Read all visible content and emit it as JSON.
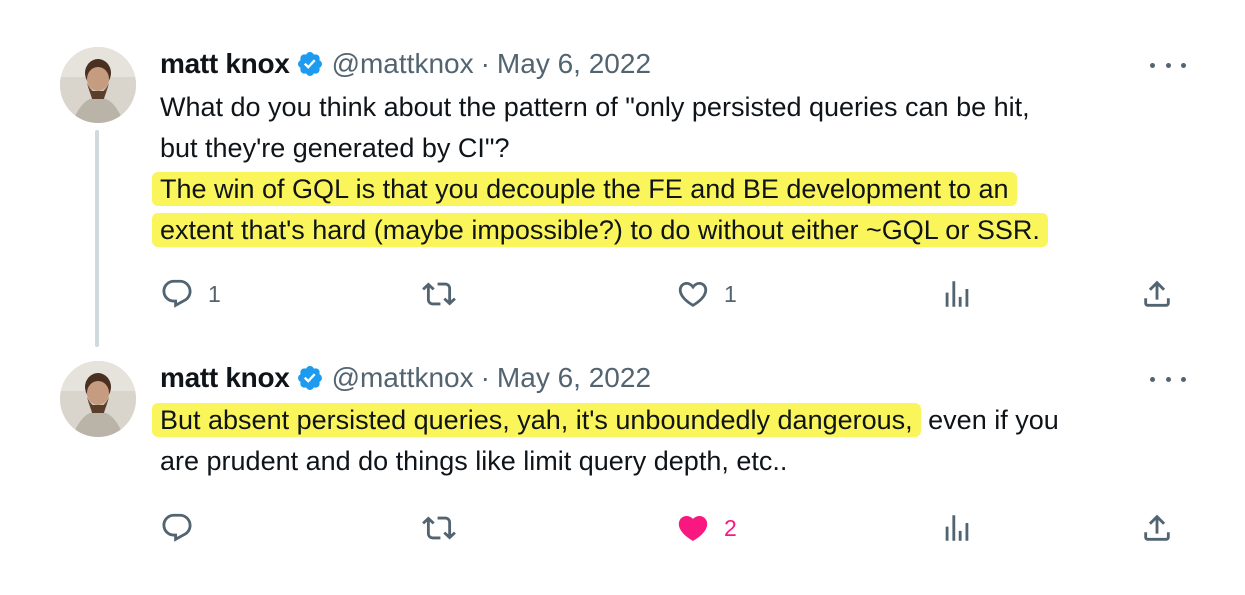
{
  "colors": {
    "accent": "#1d9bf0",
    "muted": "#536471",
    "highlight": "#fbf55c",
    "like": "#f91880"
  },
  "tweets": [
    {
      "author": {
        "name": "matt knox",
        "handle": "@mattknox",
        "date": "May 6, 2022",
        "verified": true,
        "separator": "·"
      },
      "text_lines": [
        "What do you think about the pattern of \"only persisted queries can be hit,",
        "but they're generated by CI\"?",
        "The win of GQL is that you decouple the FE and BE development to an",
        "extent that's hard (maybe impossible?) to do without either ~GQL or SSR."
      ],
      "counts": {
        "replies": "1",
        "retweets": "",
        "likes": "1"
      },
      "liked": false
    },
    {
      "author": {
        "name": "matt knox",
        "handle": "@mattknox",
        "date": "May 6, 2022",
        "verified": true,
        "separator": "·"
      },
      "text_lines_parts": {
        "line1_highlight": "But absent persisted queries, yah, it's unboundedly dangerous,",
        "line1_rest": " even if you",
        "line2": "are prudent and do things like limit query depth, etc.."
      },
      "counts": {
        "replies": "",
        "retweets": "",
        "likes": "2"
      },
      "liked": true
    }
  ]
}
